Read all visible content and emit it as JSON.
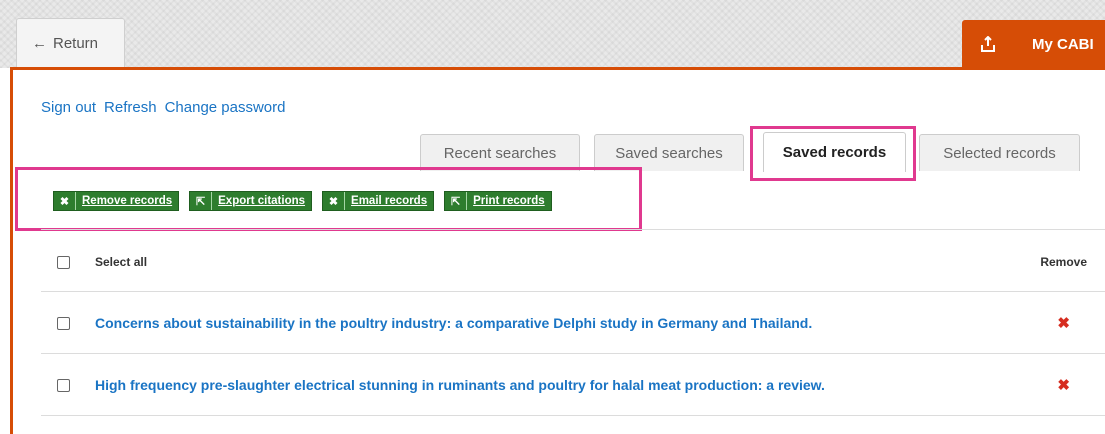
{
  "header": {
    "return_arrow": "←",
    "return_label": "Return",
    "mycabi_label": "My CABI",
    "mycabi_icon": "export-tray-icon"
  },
  "links": {
    "sign_out": "Sign out",
    "refresh": "Refresh",
    "change_password": "Change password"
  },
  "tabs": [
    {
      "label": "Recent searches",
      "active": false
    },
    {
      "label": "Saved searches",
      "active": false
    },
    {
      "label": "Saved records",
      "active": true
    },
    {
      "label": "Selected records",
      "active": false
    }
  ],
  "actions": [
    {
      "icon": "✖",
      "icon_name": "close-icon",
      "label": "Remove records"
    },
    {
      "icon": "⇱",
      "icon_name": "external-link-icon",
      "label": "Export citations"
    },
    {
      "icon": "✖",
      "icon_name": "close-icon",
      "label": "Email records"
    },
    {
      "icon": "⇱",
      "icon_name": "external-link-icon",
      "label": "Print records"
    }
  ],
  "table": {
    "select_all": "Select all",
    "remove_header": "Remove",
    "remove_icon": "✖",
    "records": [
      {
        "title": "Concerns about sustainability in the poultry industry: a comparative Delphi study in Germany and Thailand."
      },
      {
        "title": "High frequency pre-slaughter electrical stunning in ruminants and poultry for halal meat production: a review."
      }
    ]
  },
  "colors": {
    "accent_orange": "#d64d06",
    "action_green": "#2e7d2e",
    "link_blue": "#1a74c4",
    "highlight_pink": "#e0398f",
    "remove_red": "#d62d20"
  }
}
